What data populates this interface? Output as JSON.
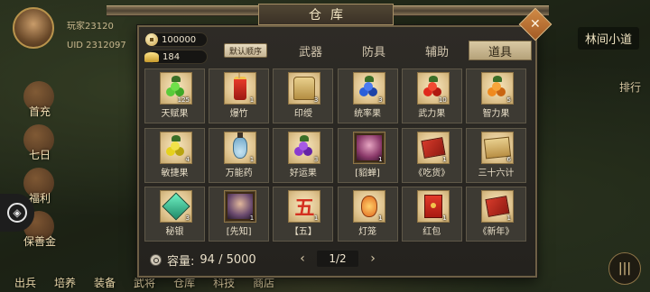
{
  "background": {
    "player": {
      "name": "玩家23120",
      "uid": "UID  2312097"
    },
    "location": "林间小道",
    "rank_label": "排行",
    "left_menu": [
      "首充",
      "七日",
      "福利",
      "保善金"
    ],
    "bottom_menu": [
      "出兵",
      "培养",
      "装备",
      "武将",
      "仓库",
      "科技",
      "商店"
    ]
  },
  "panel": {
    "title": "仓库",
    "currencies": {
      "copper": "100000",
      "gold": "184"
    },
    "sort_label": "默认顺序",
    "tabs": [
      {
        "label": "武器",
        "active": false
      },
      {
        "label": "防具",
        "active": false
      },
      {
        "label": "辅助",
        "active": false
      },
      {
        "label": "道具",
        "active": true
      }
    ],
    "items": [
      {
        "name": "天赋果",
        "count": "125",
        "icon": "berry-green-icon"
      },
      {
        "name": "爆竹",
        "count": "1",
        "icon": "firecracker-icon"
      },
      {
        "name": "印绶",
        "count": "3",
        "icon": "seal-icon"
      },
      {
        "name": "统率果",
        "count": "3",
        "icon": "berry-blue-icon"
      },
      {
        "name": "武力果",
        "count": "10",
        "icon": "berry-red-icon"
      },
      {
        "name": "智力果",
        "count": "5",
        "icon": "berry-orange-icon"
      },
      {
        "name": "敏捷果",
        "count": "4",
        "icon": "berry-yellow-icon"
      },
      {
        "name": "万能药",
        "count": "1",
        "icon": "potion-bottle-icon"
      },
      {
        "name": "好运果",
        "count": "3",
        "icon": "berry-purple-icon"
      },
      {
        "name": "[貂蝉]",
        "count": "1",
        "icon": "diaochan-portrait-icon"
      },
      {
        "name": "《吃货》",
        "count": "1",
        "icon": "red-book-icon"
      },
      {
        "name": "三十六计",
        "count": "6",
        "icon": "scroll-icon"
      },
      {
        "name": "秘银",
        "count": "3",
        "icon": "mithril-gem-icon"
      },
      {
        "name": "[先知]",
        "count": "1",
        "icon": "prophet-portrait-icon"
      },
      {
        "name": "【五】",
        "count": "1",
        "icon": "five-character-icon"
      },
      {
        "name": "灯笼",
        "count": "1",
        "icon": "lantern-icon"
      },
      {
        "name": "红包",
        "count": "1",
        "icon": "red-envelope-icon"
      },
      {
        "name": "《新年》",
        "count": "1",
        "icon": "red-book-icon"
      }
    ],
    "capacity_label": "容量:",
    "capacity_value": "94 / 5000",
    "pager": {
      "prev": "‹",
      "next": "›",
      "page": "1/2"
    }
  },
  "colors": {
    "accent": "#d9c9a3",
    "panel_bg": "#2e2b26",
    "slot_bg": "#e0c591"
  }
}
